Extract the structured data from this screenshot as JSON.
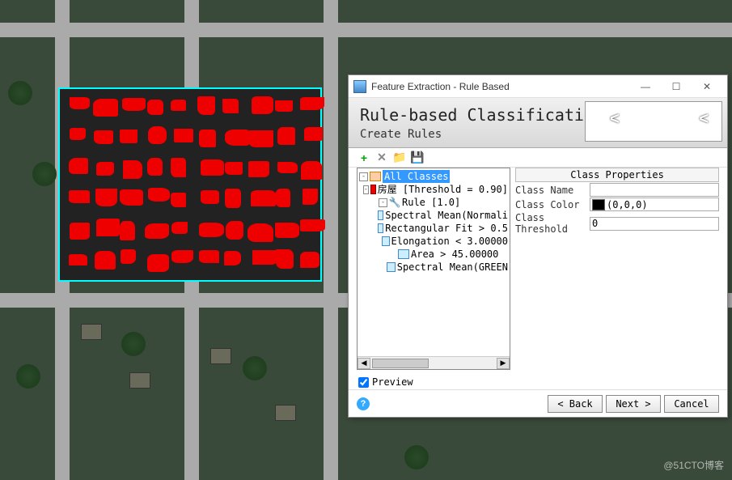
{
  "dialog": {
    "title": "Feature Extraction - Rule Based",
    "heading": "Rule-based Classification",
    "subheading": "Create Rules"
  },
  "tree": {
    "root": "All Classes",
    "class_label": "房屋 [Threshold = 0.90]",
    "rule_label": "Rule [1.0]",
    "attrs": [
      "Spectral Mean(Normali",
      "Rectangular Fit > 0.5",
      "Elongation < 3.00000",
      "Area > 45.00000",
      "Spectral Mean(GREEN "
    ]
  },
  "props": {
    "header": "Class Properties",
    "name_label": "Class Name",
    "name_value": "",
    "color_label": "Class Color",
    "color_value": "(0,0,0)",
    "threshold_label": "Class Threshold",
    "threshold_value": "0"
  },
  "preview": {
    "label": "Preview",
    "checked": true
  },
  "footer": {
    "back": "< Back",
    "next": "Next >",
    "cancel": "Cancel"
  },
  "watermark": "@51CTO博客"
}
